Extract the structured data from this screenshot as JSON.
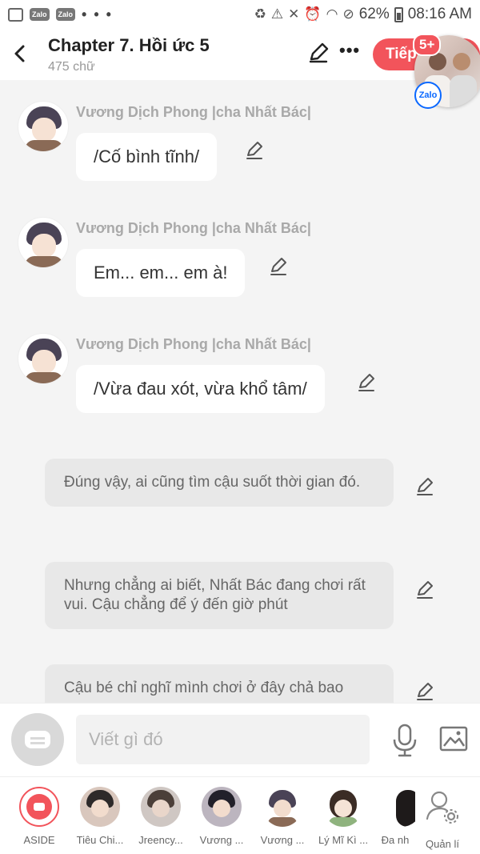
{
  "status_bar": {
    "app_icons": [
      "Zalo",
      "Zalo"
    ],
    "more": "• • •",
    "battery": "62%",
    "time": "08:16 AM"
  },
  "header": {
    "title": "Chapter 7. Hồi ức 5",
    "subtitle": "475 chữ",
    "next_label": "Tiếp",
    "badge": "5+",
    "floating_app": "Zalo"
  },
  "messages": [
    {
      "speaker": "Vương Dịch Phong |cha Nhất Bác|",
      "text": "/Cố bình tĩnh/"
    },
    {
      "speaker": "Vương Dịch Phong |cha Nhất Bác|",
      "text": "Em... em... em à!"
    },
    {
      "speaker": "Vương Dịch Phong |cha Nhất Bác|",
      "text": "/Vừa đau xót, vừa khổ tâm/"
    }
  ],
  "narrations": [
    {
      "text": "Đúng vậy, ai cũng tìm cậu suốt thời gian đó."
    },
    {
      "text": "Nhưng chẳng ai biết, Nhất Bác đang chơi rất vui. Cậu chẳng để ý đến giờ phút"
    },
    {
      "text": "Cậu bé chỉ nghĩ mình chơi ở đây chả bao"
    }
  ],
  "composer": {
    "placeholder": "Viết gì đó"
  },
  "characters": [
    {
      "label": "ASIDE"
    },
    {
      "label": "Tiêu Chi..."
    },
    {
      "label": "Jreency..."
    },
    {
      "label": "Vương ..."
    },
    {
      "label": "Vương ..."
    },
    {
      "label": "Lý Mĩ Kì ..."
    },
    {
      "label": "Đa nh"
    },
    {
      "label": "Quản lí"
    }
  ],
  "colors": {
    "accent": "#f2545b",
    "background": "#f4f4f4",
    "narration_bg": "#e8e8e8",
    "speaker_text": "#a9a9a9"
  },
  "icons": [
    "back-arrow-icon",
    "pencil-icon",
    "more-icon",
    "aside-icon",
    "microphone-icon",
    "image-icon",
    "manage-user-icon"
  ]
}
